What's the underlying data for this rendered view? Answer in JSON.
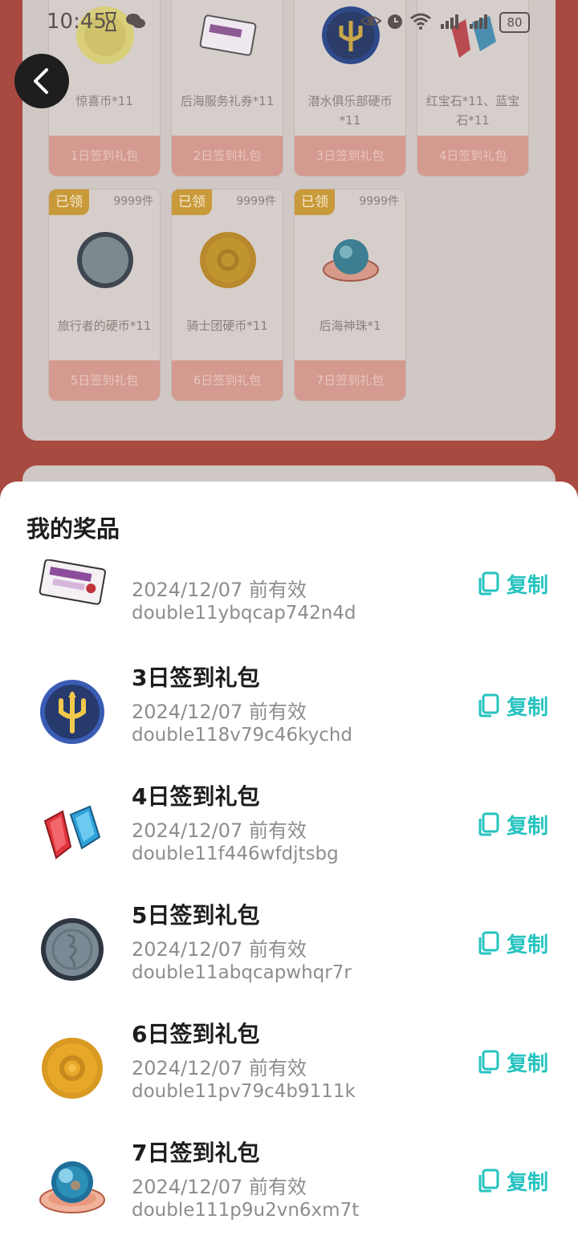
{
  "status_bar": {
    "time": "10:45",
    "battery": "80"
  },
  "background_cards": [
    {
      "name": "惊喜币*11",
      "footer": "1日签到礼包"
    },
    {
      "name": "后海服务礼券*11",
      "footer": "2日签到礼包"
    },
    {
      "name": "潜水俱乐部硬币*11",
      "footer": "3日签到礼包"
    },
    {
      "name": "红宝石*11、蓝宝石*11",
      "footer": "4日签到礼包"
    },
    {
      "name": "旅行者的硬币*11",
      "footer": "5日签到礼包",
      "badge": "已领",
      "stock": "9999件"
    },
    {
      "name": "骑士团硬币*11",
      "footer": "6日签到礼包",
      "badge": "已领",
      "stock": "9999件"
    },
    {
      "name": "后海神珠*1",
      "footer": "7日签到礼包",
      "badge": "已领",
      "stock": "9999件"
    }
  ],
  "sheet": {
    "title": "我的奖品",
    "copy_label": "复制",
    "items": [
      {
        "title": "",
        "valid": "2024/12/07 前有效",
        "code": "double11ybqcap742n4d",
        "icon": "voucher-icon"
      },
      {
        "title": "3日签到礼包",
        "valid": "2024/12/07 前有效",
        "code": "double118v79c46kychd",
        "icon": "trident-coin-icon"
      },
      {
        "title": "4日签到礼包",
        "valid": "2024/12/07 前有效",
        "code": "double11f446wfdjtsbg",
        "icon": "gems-icon"
      },
      {
        "title": "5日签到礼包",
        "valid": "2024/12/07 前有效",
        "code": "double11abqcapwhqr7r",
        "icon": "traveler-coin-icon"
      },
      {
        "title": "6日签到礼包",
        "valid": "2024/12/07 前有效",
        "code": "double11pv79c4b9111k",
        "icon": "knight-coin-icon"
      },
      {
        "title": "7日签到礼包",
        "valid": "2024/12/07 前有效",
        "code": "double111p9u2vn6xm7t",
        "icon": "pearl-icon"
      }
    ]
  }
}
